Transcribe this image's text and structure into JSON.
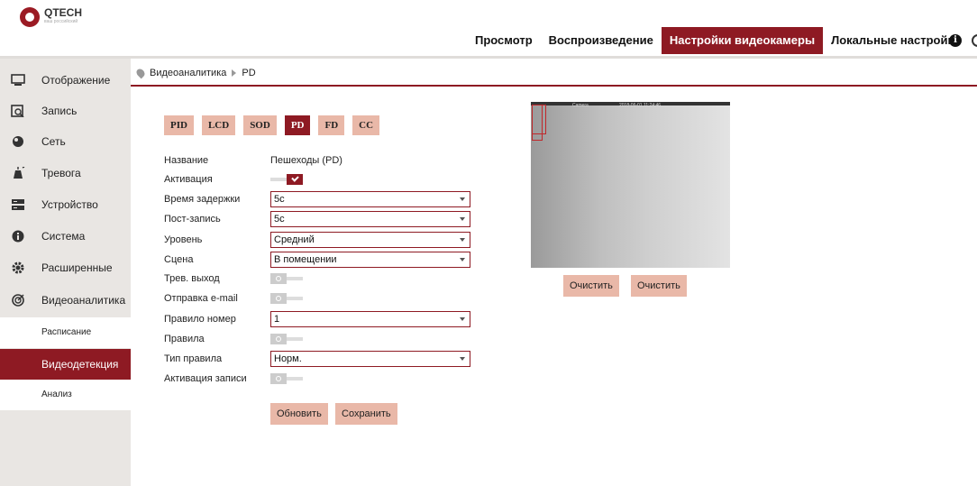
{
  "brand": {
    "name": "QTECH",
    "tagline": "ваш российский"
  },
  "nav": {
    "items": [
      "Просмотр",
      "Воспроизведение",
      "Настройки видеокамеры",
      "Локальные настройки"
    ],
    "active": "Настройки видеокамеры",
    "accent": "#8e1a23"
  },
  "sidebar": {
    "items": [
      {
        "label": "Отображение",
        "icon": "monitor-icon"
      },
      {
        "label": "Запись",
        "icon": "record-icon"
      },
      {
        "label": "Сеть",
        "icon": "network-icon"
      },
      {
        "label": "Тревога",
        "icon": "alarm-icon"
      },
      {
        "label": "Устройство",
        "icon": "device-icon"
      },
      {
        "label": "Система",
        "icon": "info-icon"
      },
      {
        "label": "Расширенные",
        "icon": "gear-icon"
      },
      {
        "label": "Видеоаналитика",
        "icon": "analytics-icon"
      }
    ],
    "subitems": [
      "Расписание",
      "Видеодетекция",
      "Анализ"
    ],
    "active_subitem": "Видеодетекция"
  },
  "breadcrumb": {
    "section": "Видеоаналитика",
    "page": "PD"
  },
  "tabs": [
    "PID",
    "LCD",
    "SOD",
    "PD",
    "FD",
    "CC"
  ],
  "active_tab": "PD",
  "form": {
    "name": {
      "label": "Название",
      "value": "Пешеходы (PD)"
    },
    "activation": {
      "label": "Активация",
      "on": true
    },
    "delay": {
      "label": "Время задержки",
      "value": "5с"
    },
    "post_record": {
      "label": "Пост-запись",
      "value": "5с"
    },
    "level": {
      "label": "Уровень",
      "value": "Средний"
    },
    "scene": {
      "label": "Сцена",
      "value": "В помещении"
    },
    "alarm_out": {
      "label": "Трев. выход",
      "on": false
    },
    "email": {
      "label": "Отправка e-mail",
      "on": false
    },
    "rule_number": {
      "label": "Правило номер",
      "value": "1"
    },
    "rules": {
      "label": "Правила",
      "on": false
    },
    "rule_type": {
      "label": "Тип правила",
      "value": "Норм."
    },
    "record_activation": {
      "label": "Активация записи",
      "on": false
    }
  },
  "buttons": {
    "refresh": "Обновить",
    "save": "Сохранить",
    "clear1": "Очистить",
    "clear2": "Очистить"
  },
  "video": {
    "osd_left": "Camera",
    "osd_right": "2018-06-01 11:24:46"
  }
}
